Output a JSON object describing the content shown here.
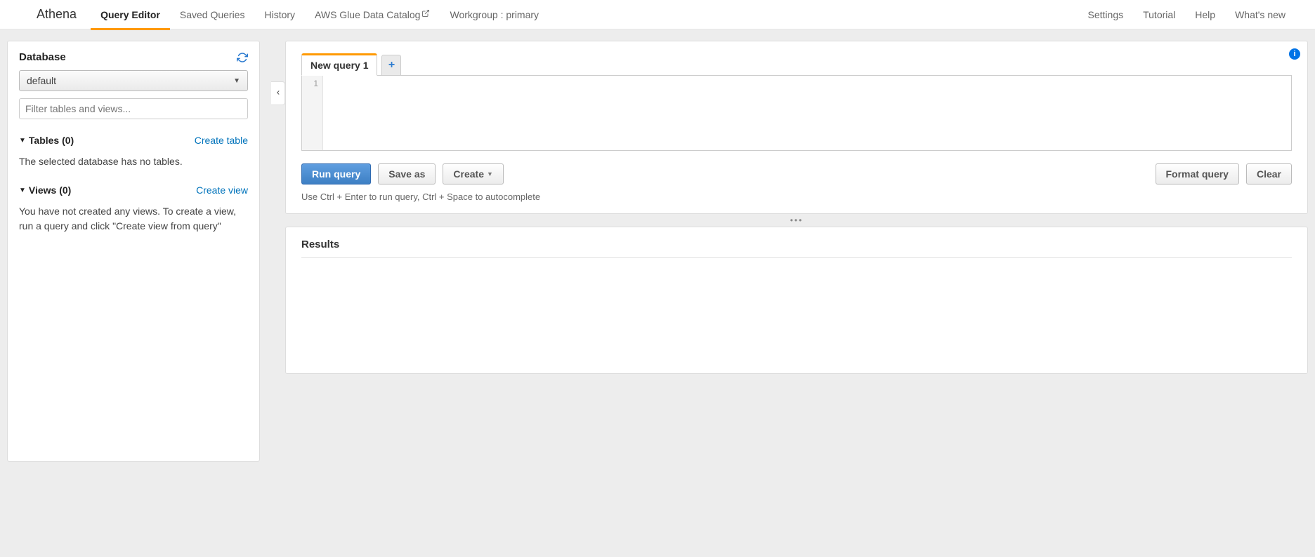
{
  "brand": "Athena",
  "nav": {
    "left": [
      {
        "label": "Query Editor",
        "active": true,
        "ext": false
      },
      {
        "label": "Saved Queries",
        "active": false,
        "ext": false
      },
      {
        "label": "History",
        "active": false,
        "ext": false
      },
      {
        "label": "AWS Glue Data Catalog",
        "active": false,
        "ext": true
      },
      {
        "label": "Workgroup : primary",
        "active": false,
        "ext": false
      }
    ],
    "right": [
      {
        "label": "Settings"
      },
      {
        "label": "Tutorial"
      },
      {
        "label": "Help"
      },
      {
        "label": "What's new"
      }
    ]
  },
  "sidebar": {
    "heading": "Database",
    "selected_database": "default",
    "filter_placeholder": "Filter tables and views...",
    "tables": {
      "label": "Tables (0)",
      "create_link": "Create table",
      "empty_msg": "The selected database has no tables."
    },
    "views": {
      "label": "Views (0)",
      "create_link": "Create view",
      "empty_msg": "You have not created any views. To create a view, run a query and click \"Create view from query\""
    }
  },
  "editor": {
    "tab_label": "New query 1",
    "line_number": "1",
    "buttons": {
      "run": "Run query",
      "save_as": "Save as",
      "create": "Create",
      "format": "Format query",
      "clear": "Clear"
    },
    "hint": "Use Ctrl + Enter to run query, Ctrl + Space to autocomplete"
  },
  "results": {
    "heading": "Results"
  }
}
